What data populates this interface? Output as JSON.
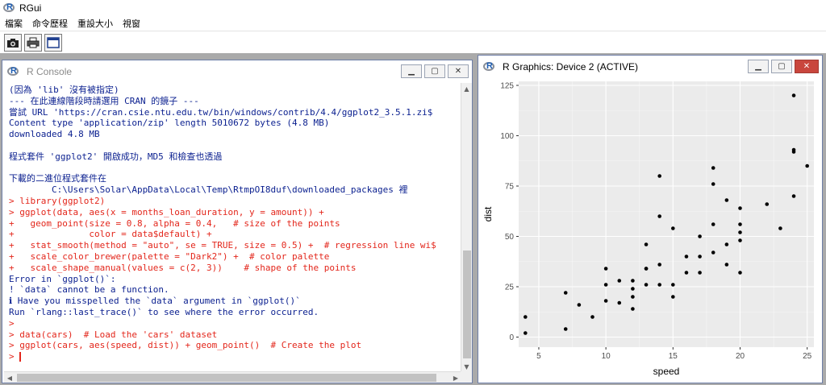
{
  "app": {
    "title": "RGui",
    "menu": [
      "檔案",
      "命令歷程",
      "重設大小",
      "視窗"
    ],
    "toolbar": [
      {
        "icon": "camera-icon"
      },
      {
        "icon": "printer-icon"
      },
      {
        "icon": "window-icon"
      }
    ]
  },
  "console": {
    "title": "R Console",
    "lines": [
      {
        "kind": "out",
        "text": "(因為 'lib' 沒有被指定)"
      },
      {
        "kind": "out",
        "text": "--- 在此連線階段時請選用 CRAN 的鏡子 ---"
      },
      {
        "kind": "out",
        "text": "嘗試 URL 'https://cran.csie.ntu.edu.tw/bin/windows/contrib/4.4/ggplot2_3.5.1.zi$"
      },
      {
        "kind": "out",
        "text": "Content type 'application/zip' length 5010672 bytes (4.8 MB)"
      },
      {
        "kind": "out",
        "text": "downloaded 4.8 MB"
      },
      {
        "kind": "blank",
        "text": ""
      },
      {
        "kind": "out",
        "text": "程式套件 'ggplot2' 開啟成功，MD5 和檢查也透過"
      },
      {
        "kind": "blank",
        "text": ""
      },
      {
        "kind": "out",
        "text": "下載的二進位程式套件在"
      },
      {
        "kind": "out",
        "text": "        C:\\Users\\Solar\\AppData\\Local\\Temp\\RtmpOI8duf\\downloaded_packages 裡"
      },
      {
        "kind": "in",
        "text": "> library(ggplot2)"
      },
      {
        "kind": "in",
        "text": "> ggplot(data, aes(x = months_loan_duration, y = amount)) +"
      },
      {
        "kind": "in",
        "text": "+   geom_point(size = 0.8, alpha = 0.4,   # size of the points"
      },
      {
        "kind": "in",
        "text": "+              color = data$default) +"
      },
      {
        "kind": "in",
        "text": "+   stat_smooth(method = \"auto\", se = TRUE, size = 0.5) +  # regression line wi$"
      },
      {
        "kind": "in",
        "text": "+   scale_color_brewer(palette = \"Dark2\") +  # color palette"
      },
      {
        "kind": "in",
        "text": "+   scale_shape_manual(values = c(2, 3))    # shape of the points"
      },
      {
        "kind": "out",
        "text": "Error in `ggplot()`:"
      },
      {
        "kind": "out",
        "text": "! `data` cannot be a function."
      },
      {
        "kind": "out",
        "text": "ℹ Have you misspelled the `data` argument in `ggplot()`"
      },
      {
        "kind": "out",
        "text": "Run `rlang::last_trace()` to see where the error occurred."
      },
      {
        "kind": "in",
        "text": ">"
      },
      {
        "kind": "in",
        "text": "> data(cars)  # Load the 'cars' dataset"
      },
      {
        "kind": "in",
        "text": "> ggplot(cars, aes(speed, dist)) + geom_point()  # Create the plot"
      },
      {
        "kind": "in",
        "text": "> "
      }
    ]
  },
  "graphics": {
    "title": "R Graphics: Device 2 (ACTIVE)"
  },
  "chart_data": {
    "type": "scatter",
    "xlabel": "speed",
    "ylabel": "dist",
    "xlim": [
      3.5,
      25.5
    ],
    "ylim": [
      -5,
      127
    ],
    "xticks": [
      5,
      10,
      15,
      20,
      25
    ],
    "yticks": [
      0,
      25,
      50,
      75,
      100,
      125
    ],
    "grid": true,
    "background": "#ebebeb",
    "points": [
      [
        4,
        2
      ],
      [
        4,
        10
      ],
      [
        7,
        4
      ],
      [
        7,
        22
      ],
      [
        8,
        16
      ],
      [
        9,
        10
      ],
      [
        10,
        18
      ],
      [
        10,
        26
      ],
      [
        10,
        34
      ],
      [
        11,
        17
      ],
      [
        11,
        28
      ],
      [
        12,
        14
      ],
      [
        12,
        20
      ],
      [
        12,
        24
      ],
      [
        12,
        28
      ],
      [
        13,
        26
      ],
      [
        13,
        34
      ],
      [
        13,
        34
      ],
      [
        13,
        46
      ],
      [
        14,
        26
      ],
      [
        14,
        36
      ],
      [
        14,
        60
      ],
      [
        14,
        80
      ],
      [
        15,
        20
      ],
      [
        15,
        26
      ],
      [
        15,
        54
      ],
      [
        16,
        32
      ],
      [
        16,
        40
      ],
      [
        17,
        32
      ],
      [
        17,
        40
      ],
      [
        17,
        50
      ],
      [
        18,
        42
      ],
      [
        18,
        56
      ],
      [
        18,
        76
      ],
      [
        18,
        84
      ],
      [
        19,
        36
      ],
      [
        19,
        46
      ],
      [
        19,
        68
      ],
      [
        20,
        32
      ],
      [
        20,
        48
      ],
      [
        20,
        52
      ],
      [
        20,
        56
      ],
      [
        20,
        64
      ],
      [
        22,
        66
      ],
      [
        23,
        54
      ],
      [
        24,
        70
      ],
      [
        24,
        92
      ],
      [
        24,
        93
      ],
      [
        24,
        120
      ],
      [
        25,
        85
      ]
    ]
  },
  "colors": {
    "console_output": "#0a1f8f",
    "console_input": "#e3261b",
    "plot_panel": "#ebebeb",
    "mdi_background": "#aaaaaa"
  }
}
